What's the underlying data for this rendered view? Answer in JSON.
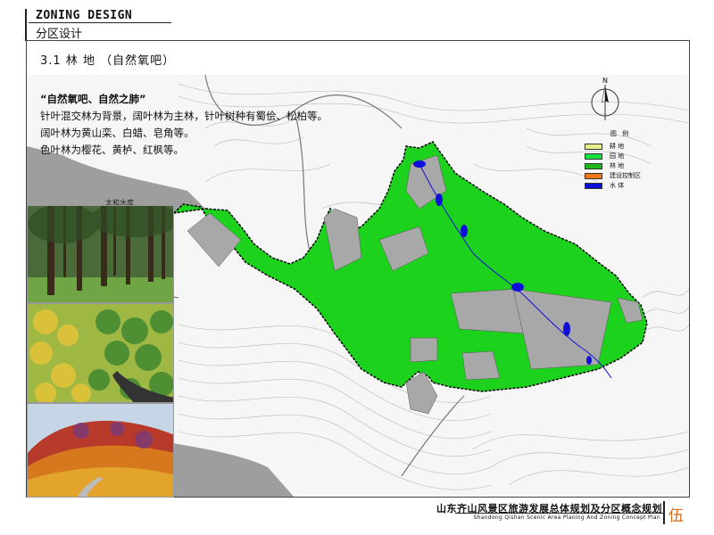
{
  "header": {
    "title_en": "ZONING DESIGN",
    "title_cn": "分区设计"
  },
  "section": {
    "title": "3.1  林  地 （自然氧吧）"
  },
  "description": {
    "quote": "“自然氧吧、自然之肺”",
    "lines": [
      "针叶混交林为背景，阔叶林为主林，针叶树种有蜀侩、松柏等。",
      "阔叶林为黄山栾、白蜡、皂角等。",
      "色叶林为樱花、黄栌、红枫等。"
    ]
  },
  "map": {
    "reservoir_label": "太和水库",
    "colors": {
      "forest": "#1cd21c",
      "construction": "#a8a8a8",
      "water": "#1010d8"
    }
  },
  "compass": {
    "label": "N"
  },
  "legend": {
    "title": "图 例",
    "items": [
      {
        "label": "耕 地",
        "color": "#e6f08c"
      },
      {
        "label": "园 地",
        "color": "#18e040"
      },
      {
        "label": "林 地",
        "color": "#1cb81c"
      },
      {
        "label": "建设控制区",
        "color": "#f07818"
      },
      {
        "label": "水 体",
        "color": "#0a10d8"
      }
    ]
  },
  "footer": {
    "title_cn": "山东齐山风景区旅游发展总体规划及分区概念规划",
    "title_en": "Shandong Qishan Scenic Area Planing And Zoning Concept Plan",
    "page_number": "伍"
  }
}
